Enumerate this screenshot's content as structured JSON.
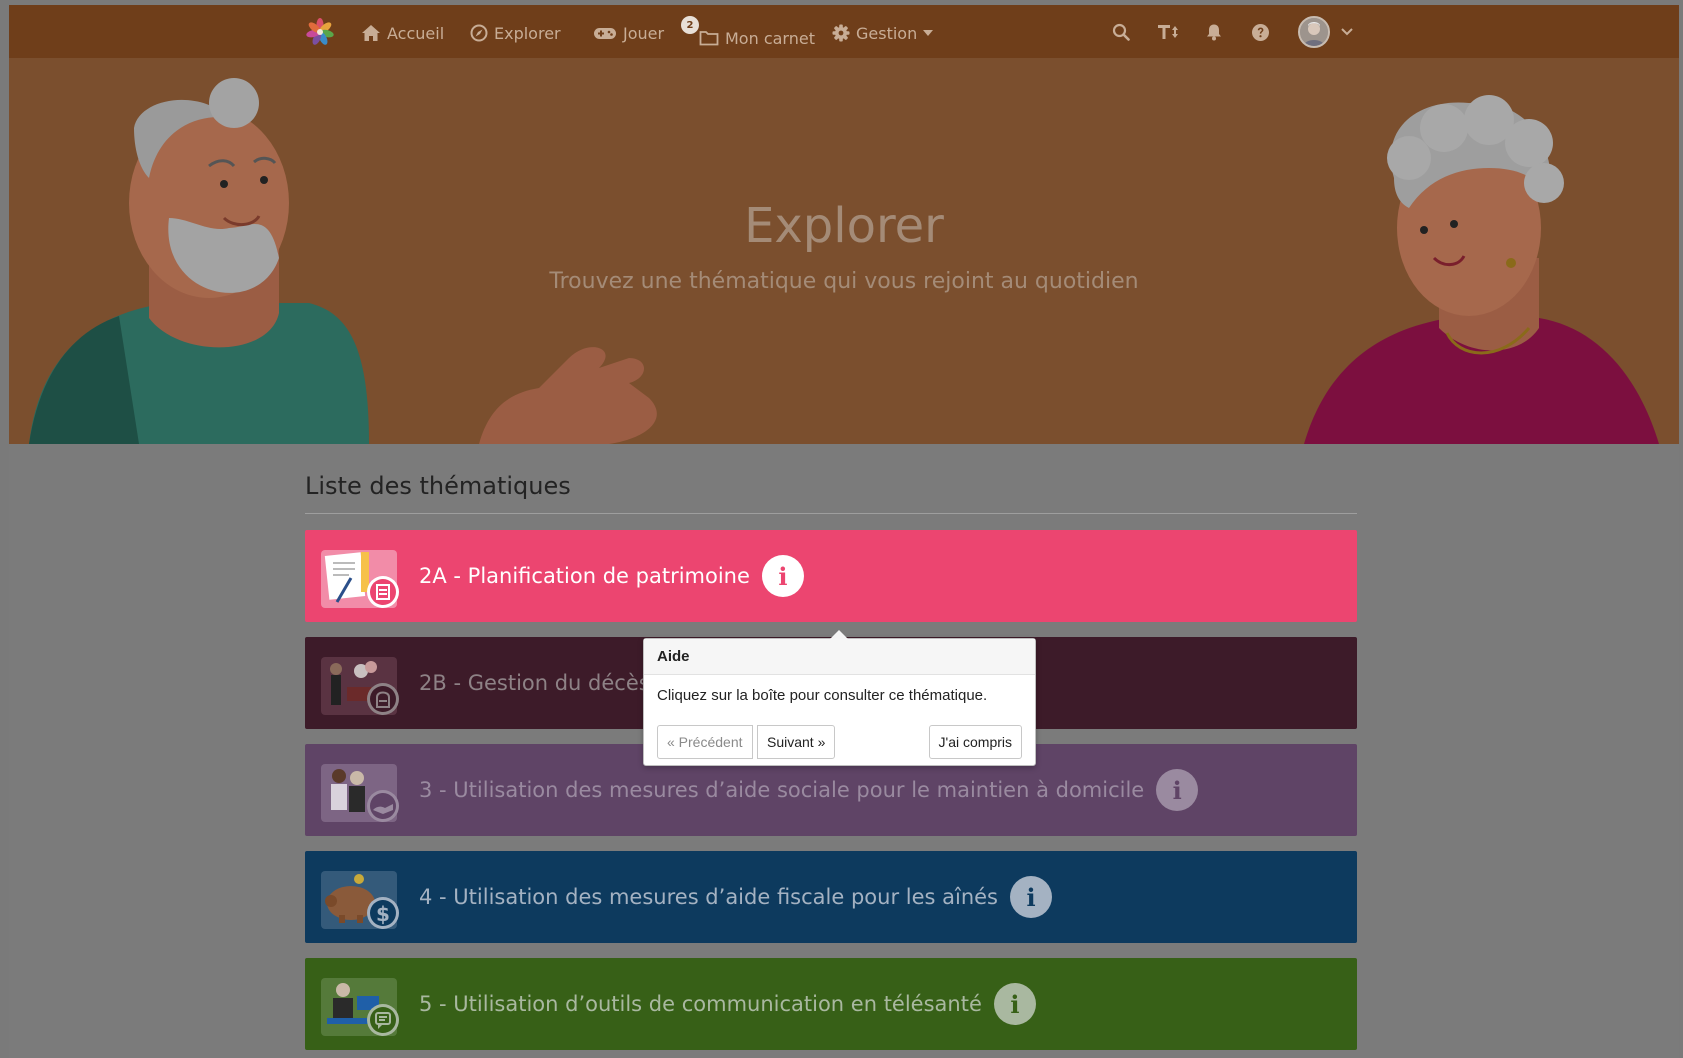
{
  "nav": {
    "items": [
      {
        "label": "Accueil",
        "icon": "home-icon"
      },
      {
        "label": "Explorer",
        "icon": "compass-icon"
      },
      {
        "label": "Jouer",
        "icon": "gamepad-icon"
      },
      {
        "label": "Mon carnet",
        "icon": "folder-icon",
        "badge": "2"
      },
      {
        "label": "Gestion",
        "icon": "gear-icon"
      }
    ],
    "icons": [
      "search-icon",
      "text-size-icon",
      "bell-icon",
      "help-icon",
      "avatar"
    ]
  },
  "hero": {
    "title": "Explorer",
    "subtitle": "Trouvez une thématique qui vous rejoint au quotidien"
  },
  "list": {
    "title": "Liste des thématiques",
    "cards": [
      {
        "label": "2A - Planification de patrimoine",
        "color": "#ec4570",
        "text_color": "#ffffff"
      },
      {
        "label": "2B - Gestion du décès e",
        "color": "#3d1b29",
        "text_color": "#8e8286"
      },
      {
        "label": "3 - Utilisation des mesures d’aide sociale pour le maintien à domicile",
        "color": "#5f4466",
        "text_color": "#9a8aa0"
      },
      {
        "label": "4 - Utilisation des mesures d’aide fiscale pour les aînés",
        "color": "#0d3a5e",
        "text_color": "#a4b2c2"
      },
      {
        "label": "5 - Utilisation d’outils de communication en télésanté",
        "color": "#376017",
        "text_color": "#a9b8a0"
      }
    ]
  },
  "popover": {
    "title": "Aide",
    "body": "Cliquez sur la boîte pour consulter ce thématique.",
    "prev": "« Précédent",
    "next": "Suivant »",
    "done": "J'ai compris"
  }
}
